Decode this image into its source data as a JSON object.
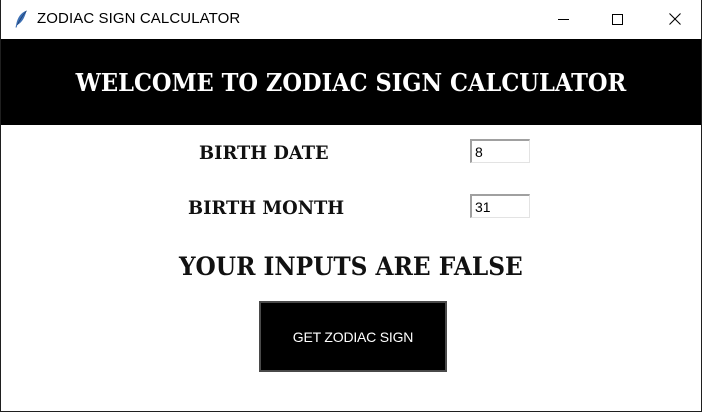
{
  "window": {
    "title": "ZODIAC SIGN CALCULATOR",
    "app_icon": "feather-icon",
    "controls": {
      "minimize_icon": "minimize-icon",
      "maximize_icon": "maximize-icon",
      "close_icon": "close-icon"
    }
  },
  "banner": {
    "title": "WELCOME TO ZODIAC SIGN CALCULATOR",
    "background": "#000000",
    "text_color": "#ffffff"
  },
  "form": {
    "birth_date": {
      "label": "BIRTH DATE",
      "value": "8"
    },
    "birth_month": {
      "label": "BIRTH MONTH",
      "value": "31"
    }
  },
  "result": {
    "text": "YOUR INPUTS ARE FALSE"
  },
  "button": {
    "label": "GET ZODIAC SIGN",
    "background": "#000000"
  }
}
